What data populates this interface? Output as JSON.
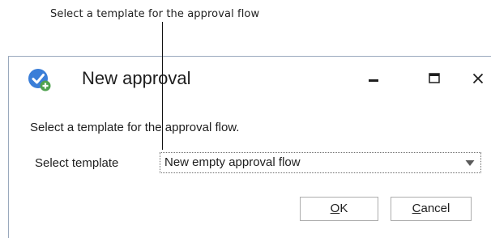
{
  "callout": {
    "text": "Select a template for the approval flow"
  },
  "dialog": {
    "title": "New approval",
    "instruction": "Select a template for the approval flow.",
    "template_label": "Select template",
    "template_selected": "New empty approval flow",
    "buttons": {
      "ok_mnemonic": "O",
      "ok_rest": "K",
      "cancel_mnemonic": "C",
      "cancel_rest": "ancel"
    },
    "window_controls": {
      "minimize_icon": "minimize-icon",
      "maximize_icon": "maximize-icon",
      "close_icon": "close-icon"
    }
  },
  "colors": {
    "accent_blue": "#3a7ed8",
    "accent_green": "#4fa24f",
    "border": "#9aa9bd",
    "text": "#1e1e1e"
  }
}
